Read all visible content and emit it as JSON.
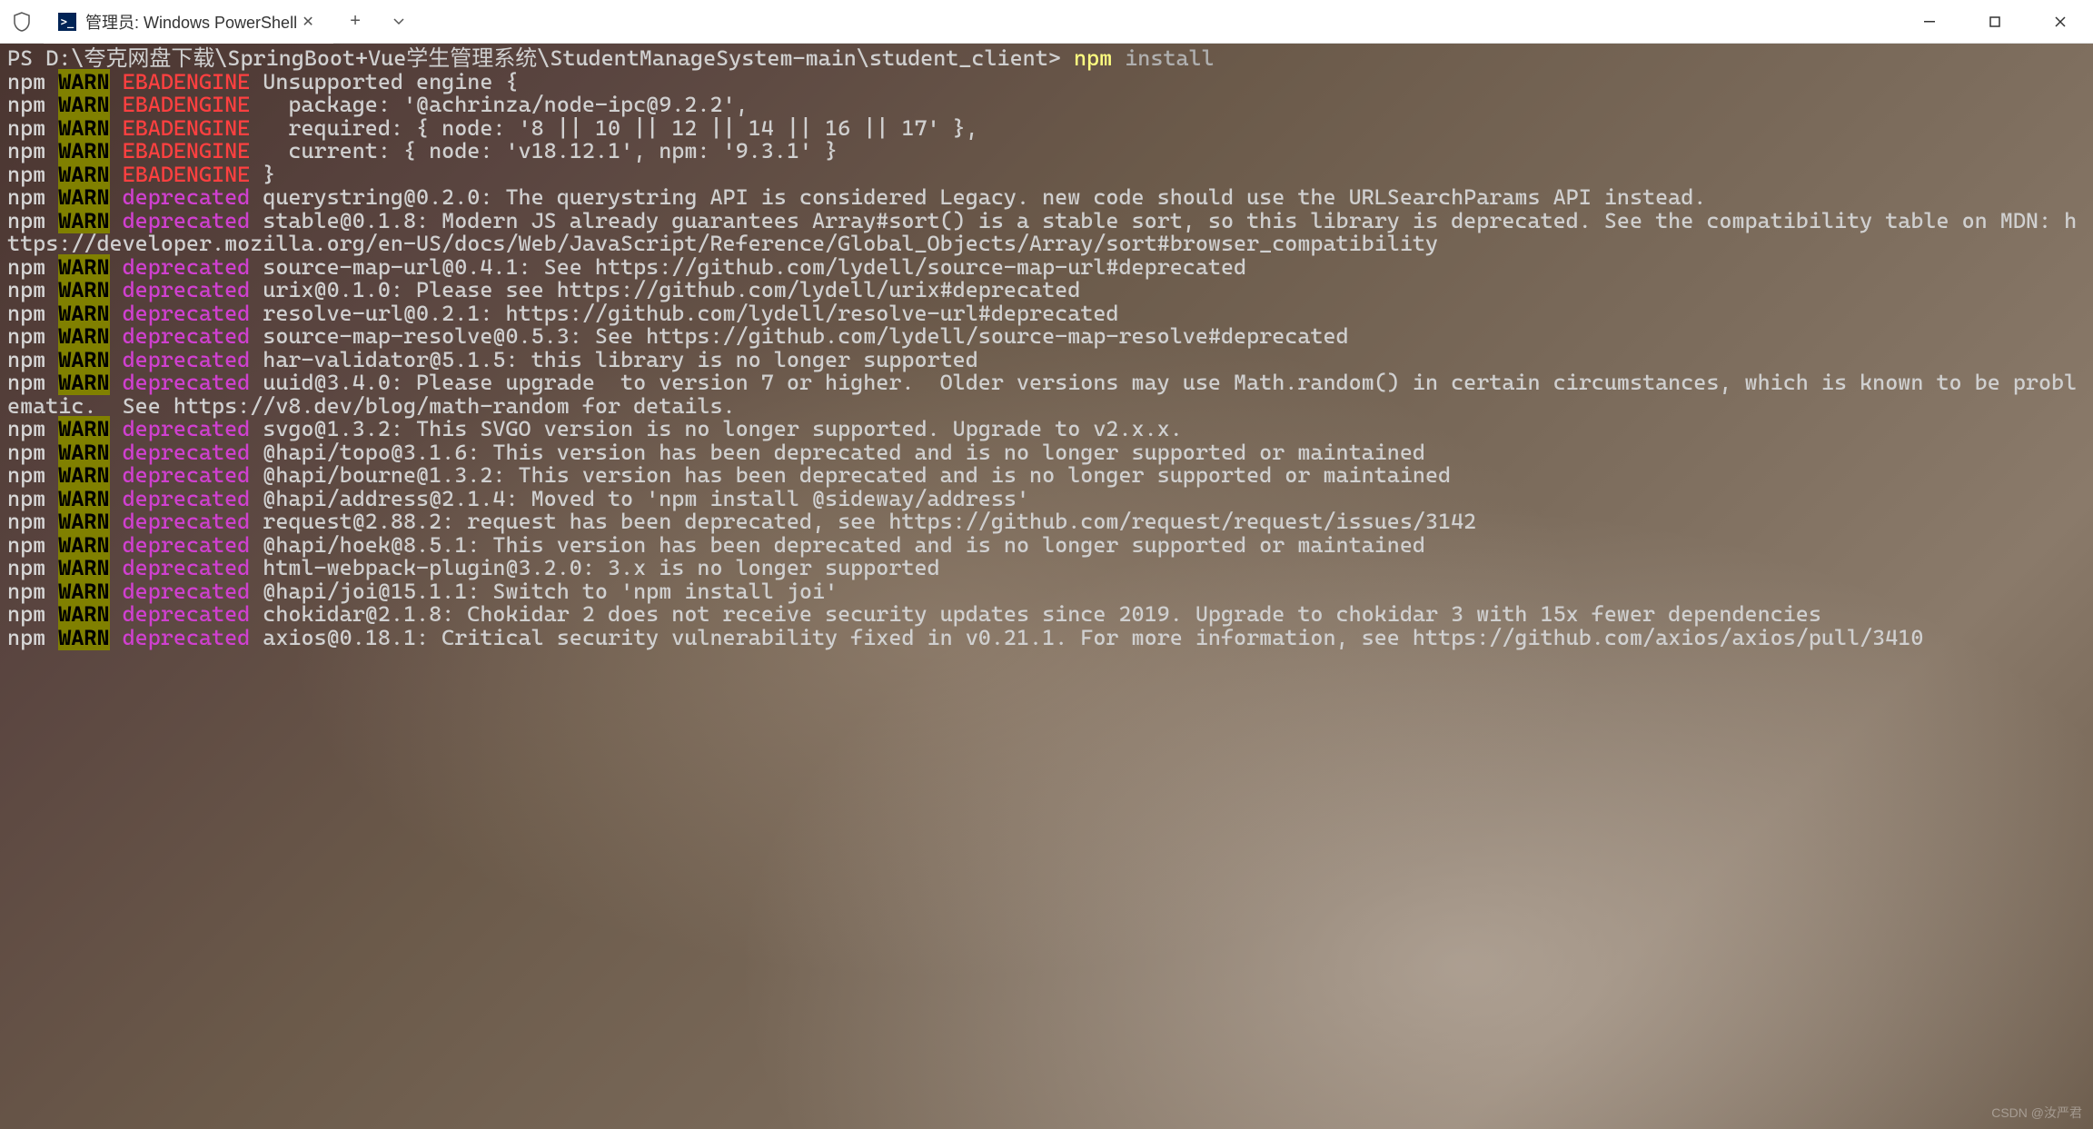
{
  "tab": {
    "icon_text": ">_",
    "title": "管理员: Windows PowerShell"
  },
  "prompt": "PS D:\\夸克网盘下载\\SpringBoot+Vue学生管理系统\\StudentManageSystem-main\\student_client> ",
  "command": {
    "name": "npm",
    "args": " install"
  },
  "lines": [
    {
      "type": "ebad",
      "msg": "Unsupported engine {"
    },
    {
      "type": "ebad",
      "msg": "  package: '@achrinza/node-ipc@9.2.2',"
    },
    {
      "type": "ebad",
      "msg": "  required: { node: '8 || 10 || 12 || 14 || 16 || 17' },"
    },
    {
      "type": "ebad",
      "msg": "  current: { node: 'v18.12.1', npm: '9.3.1' }"
    },
    {
      "type": "ebad",
      "msg": "}"
    },
    {
      "type": "dep",
      "msg": "querystring@0.2.0: The querystring API is considered Legacy. new code should use the URLSearchParams API instead."
    },
    {
      "type": "dep",
      "msg": "stable@0.1.8: Modern JS already guarantees Array#sort() is a stable sort, so this library is deprecated. See the compatibility table on MDN: https://developer.mozilla.org/en-US/docs/Web/JavaScript/Reference/Global_Objects/Array/sort#browser_compatibility"
    },
    {
      "type": "dep",
      "msg": "source-map-url@0.4.1: See https://github.com/lydell/source-map-url#deprecated"
    },
    {
      "type": "dep",
      "msg": "urix@0.1.0: Please see https://github.com/lydell/urix#deprecated"
    },
    {
      "type": "dep",
      "msg": "resolve-url@0.2.1: https://github.com/lydell/resolve-url#deprecated"
    },
    {
      "type": "dep",
      "msg": "source-map-resolve@0.5.3: See https://github.com/lydell/source-map-resolve#deprecated"
    },
    {
      "type": "dep",
      "msg": "har-validator@5.1.5: this library is no longer supported"
    },
    {
      "type": "dep",
      "msg": "uuid@3.4.0: Please upgrade  to version 7 or higher.  Older versions may use Math.random() in certain circumstances, which is known to be problematic.  See https://v8.dev/blog/math-random for details."
    },
    {
      "type": "dep",
      "msg": "svgo@1.3.2: This SVGO version is no longer supported. Upgrade to v2.x.x."
    },
    {
      "type": "dep",
      "msg": "@hapi/topo@3.1.6: This version has been deprecated and is no longer supported or maintained"
    },
    {
      "type": "dep",
      "msg": "@hapi/bourne@1.3.2: This version has been deprecated and is no longer supported or maintained"
    },
    {
      "type": "dep",
      "msg": "@hapi/address@2.1.4: Moved to 'npm install @sideway/address'"
    },
    {
      "type": "dep",
      "msg": "request@2.88.2: request has been deprecated, see https://github.com/request/request/issues/3142"
    },
    {
      "type": "dep",
      "msg": "@hapi/hoek@8.5.1: This version has been deprecated and is no longer supported or maintained"
    },
    {
      "type": "dep",
      "msg": "html-webpack-plugin@3.2.0: 3.x is no longer supported"
    },
    {
      "type": "dep",
      "msg": "@hapi/joi@15.1.1: Switch to 'npm install joi'"
    },
    {
      "type": "dep",
      "msg": "chokidar@2.1.8: Chokidar 2 does not receive security updates since 2019. Upgrade to chokidar 3 with 15x fewer dependencies"
    },
    {
      "type": "dep",
      "msg": "axios@0.18.1: Critical security vulnerability fixed in v0.21.1. For more information, see https://github.com/axios/axios/pull/3410"
    }
  ],
  "labels": {
    "npm": "npm",
    "warn": "WARN",
    "ebadengine": "EBADENGINE",
    "deprecated": "deprecated"
  },
  "watermark": "CSDN @汝严君"
}
